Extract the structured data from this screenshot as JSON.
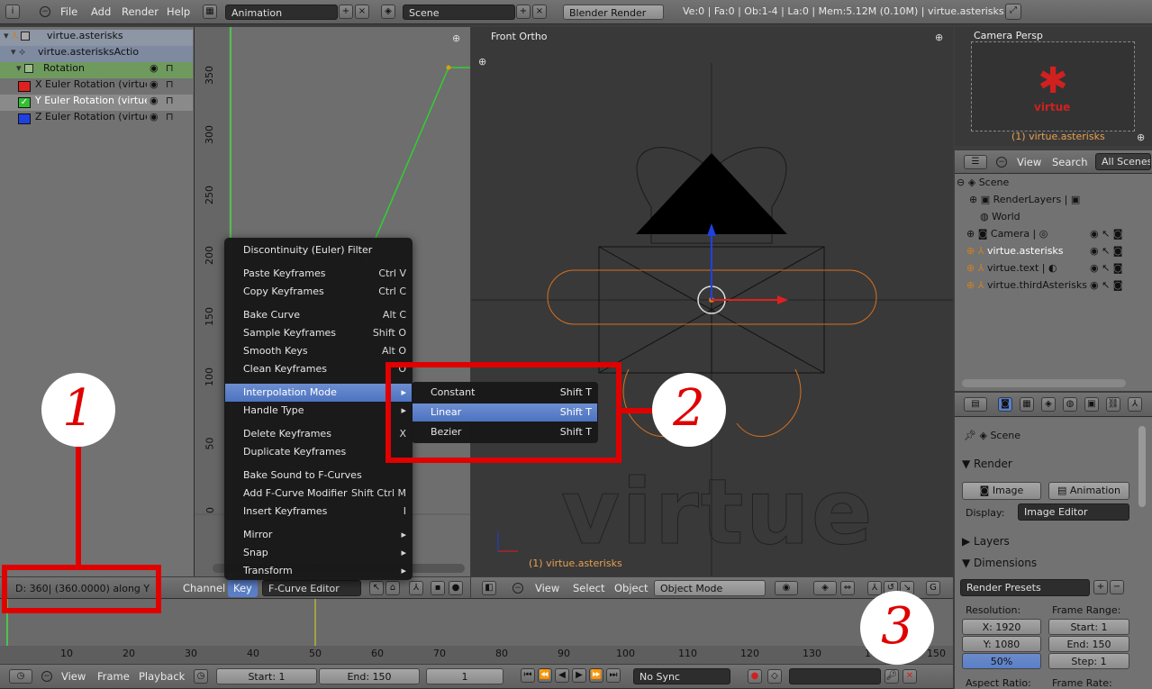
{
  "info_header": {
    "menus": [
      "File",
      "Add",
      "Render",
      "Help"
    ],
    "screen_layout": "Animation",
    "scene": "Scene",
    "render_engine": "Blender Render",
    "stats": "Ve:0 | Fa:0 | Ob:1-4 | La:0 | Mem:5.12M (0.10M) | virtue.asterisks"
  },
  "channels": [
    {
      "label": "virtue.asterisks"
    },
    {
      "label": "virtue.asterisksActio"
    },
    {
      "label": "Rotation"
    },
    {
      "label": "X Euler Rotation (virtue.a"
    },
    {
      "label": "Y Euler Rotation (virtue.a"
    },
    {
      "label": "Z Euler Rotation (virtue.a"
    }
  ],
  "graph": {
    "y_ticks": [
      "350",
      "300",
      "250",
      "200",
      "150",
      "100",
      "50",
      "0"
    ],
    "x_tick_visible": "20",
    "status_text": "D: 360| (360.0000) along Y"
  },
  "graph_header": {
    "menus": [
      "Channel",
      "Key"
    ],
    "mode": "F-Curve Editor"
  },
  "key_menu": {
    "items": [
      {
        "label": "Discontinuity (Euler) Filter",
        "shortcut": ""
      },
      {
        "label": "Paste Keyframes",
        "shortcut": "Ctrl V"
      },
      {
        "label": "Copy Keyframes",
        "shortcut": "Ctrl C"
      },
      {
        "label": "Bake Curve",
        "shortcut": "Alt C"
      },
      {
        "label": "Sample Keyframes",
        "shortcut": "Shift O"
      },
      {
        "label": "Smooth Keys",
        "shortcut": "Alt O"
      },
      {
        "label": "Clean Keyframes",
        "shortcut": "O"
      },
      {
        "label": "Interpolation Mode",
        "shortcut": ""
      },
      {
        "label": "Handle Type",
        "shortcut": ""
      },
      {
        "label": "Delete Keyframes",
        "shortcut": "X"
      },
      {
        "label": "Duplicate Keyframes",
        "shortcut": ""
      },
      {
        "label": "Bake Sound to F-Curves",
        "shortcut": ""
      },
      {
        "label": "Add F-Curve Modifier",
        "shortcut": "Shift Ctrl M"
      },
      {
        "label": "Insert Keyframes",
        "shortcut": "I"
      },
      {
        "label": "Mirror",
        "shortcut": ""
      },
      {
        "label": "Snap",
        "shortcut": ""
      },
      {
        "label": "Transform",
        "shortcut": ""
      }
    ]
  },
  "interpolation_submenu": {
    "items": [
      {
        "label": "Constant",
        "shortcut": "Shift T"
      },
      {
        "label": "Linear",
        "shortcut": "Shift T"
      },
      {
        "label": "Bezier",
        "shortcut": "Shift T"
      }
    ]
  },
  "view3d": {
    "view_label": "Front Ortho",
    "object_label": "(1) virtue.asterisks",
    "text_object": "virtue",
    "menus": [
      "View",
      "Select",
      "Object"
    ],
    "mode": "Object Mode"
  },
  "camera_view": {
    "view_label": "Camera Persp",
    "object_label": "(1) virtue.asterisks",
    "logo_text": "virtue"
  },
  "outliner": {
    "menus": [
      "View",
      "Search"
    ],
    "display_mode": "All Scenes",
    "items": [
      {
        "label": "Scene"
      },
      {
        "label": "RenderLayers"
      },
      {
        "label": "World"
      },
      {
        "label": "Camera"
      },
      {
        "label": "virtue.asterisks"
      },
      {
        "label": "virtue.text"
      },
      {
        "label": "virtue.thirdAsterisks"
      }
    ]
  },
  "properties": {
    "scene": "Scene",
    "render_panel": "Render",
    "image_button": "Image",
    "animation_button": "Animation",
    "display_label": "Display:",
    "display_value": "Image Editor",
    "layers_panel": "Layers",
    "dimensions_panel": "Dimensions",
    "render_presets": "Render Presets",
    "resolution_label": "Resolution:",
    "frame_range_label": "Frame Range:",
    "res_x": "X: 1920",
    "res_y": "Y: 1080",
    "res_pct": "50%",
    "start": "Start: 1",
    "end": "End: 150",
    "step": "Step: 1",
    "aspect_label": "Aspect Ratio:",
    "frame_rate_label": "Frame Rate:"
  },
  "timeline": {
    "ticks": [
      "10",
      "20",
      "30",
      "40",
      "50",
      "60",
      "70",
      "80",
      "90",
      "100",
      "110",
      "120",
      "130",
      "140",
      "150"
    ],
    "menus": [
      "View",
      "Frame",
      "Playback"
    ],
    "start": "Start: 1",
    "end": "End: 150",
    "current": "1",
    "sync": "No Sync"
  },
  "annotations": [
    "1",
    "2",
    "3"
  ],
  "colors": {
    "red_annotation": "#e00000",
    "menu_highlight": "#5a7fc8",
    "curve_green": "#30d030",
    "selection_orange": "#d7701e"
  }
}
